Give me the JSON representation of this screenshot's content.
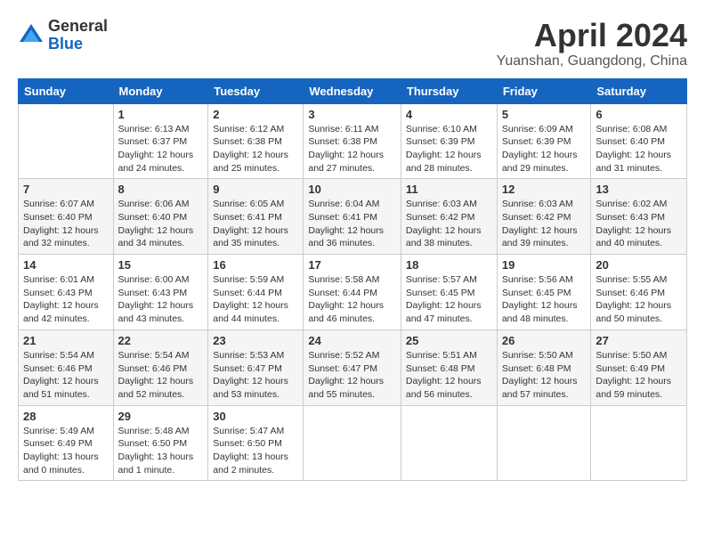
{
  "logo": {
    "general": "General",
    "blue": "Blue"
  },
  "title": "April 2024",
  "location": "Yuanshan, Guangdong, China",
  "columns": [
    "Sunday",
    "Monday",
    "Tuesday",
    "Wednesday",
    "Thursday",
    "Friday",
    "Saturday"
  ],
  "weeks": [
    [
      {
        "day": "",
        "info": ""
      },
      {
        "day": "1",
        "info": "Sunrise: 6:13 AM\nSunset: 6:37 PM\nDaylight: 12 hours\nand 24 minutes."
      },
      {
        "day": "2",
        "info": "Sunrise: 6:12 AM\nSunset: 6:38 PM\nDaylight: 12 hours\nand 25 minutes."
      },
      {
        "day": "3",
        "info": "Sunrise: 6:11 AM\nSunset: 6:38 PM\nDaylight: 12 hours\nand 27 minutes."
      },
      {
        "day": "4",
        "info": "Sunrise: 6:10 AM\nSunset: 6:39 PM\nDaylight: 12 hours\nand 28 minutes."
      },
      {
        "day": "5",
        "info": "Sunrise: 6:09 AM\nSunset: 6:39 PM\nDaylight: 12 hours\nand 29 minutes."
      },
      {
        "day": "6",
        "info": "Sunrise: 6:08 AM\nSunset: 6:40 PM\nDaylight: 12 hours\nand 31 minutes."
      }
    ],
    [
      {
        "day": "7",
        "info": "Sunrise: 6:07 AM\nSunset: 6:40 PM\nDaylight: 12 hours\nand 32 minutes."
      },
      {
        "day": "8",
        "info": "Sunrise: 6:06 AM\nSunset: 6:40 PM\nDaylight: 12 hours\nand 34 minutes."
      },
      {
        "day": "9",
        "info": "Sunrise: 6:05 AM\nSunset: 6:41 PM\nDaylight: 12 hours\nand 35 minutes."
      },
      {
        "day": "10",
        "info": "Sunrise: 6:04 AM\nSunset: 6:41 PM\nDaylight: 12 hours\nand 36 minutes."
      },
      {
        "day": "11",
        "info": "Sunrise: 6:03 AM\nSunset: 6:42 PM\nDaylight: 12 hours\nand 38 minutes."
      },
      {
        "day": "12",
        "info": "Sunrise: 6:03 AM\nSunset: 6:42 PM\nDaylight: 12 hours\nand 39 minutes."
      },
      {
        "day": "13",
        "info": "Sunrise: 6:02 AM\nSunset: 6:43 PM\nDaylight: 12 hours\nand 40 minutes."
      }
    ],
    [
      {
        "day": "14",
        "info": "Sunrise: 6:01 AM\nSunset: 6:43 PM\nDaylight: 12 hours\nand 42 minutes."
      },
      {
        "day": "15",
        "info": "Sunrise: 6:00 AM\nSunset: 6:43 PM\nDaylight: 12 hours\nand 43 minutes."
      },
      {
        "day": "16",
        "info": "Sunrise: 5:59 AM\nSunset: 6:44 PM\nDaylight: 12 hours\nand 44 minutes."
      },
      {
        "day": "17",
        "info": "Sunrise: 5:58 AM\nSunset: 6:44 PM\nDaylight: 12 hours\nand 46 minutes."
      },
      {
        "day": "18",
        "info": "Sunrise: 5:57 AM\nSunset: 6:45 PM\nDaylight: 12 hours\nand 47 minutes."
      },
      {
        "day": "19",
        "info": "Sunrise: 5:56 AM\nSunset: 6:45 PM\nDaylight: 12 hours\nand 48 minutes."
      },
      {
        "day": "20",
        "info": "Sunrise: 5:55 AM\nSunset: 6:46 PM\nDaylight: 12 hours\nand 50 minutes."
      }
    ],
    [
      {
        "day": "21",
        "info": "Sunrise: 5:54 AM\nSunset: 6:46 PM\nDaylight: 12 hours\nand 51 minutes."
      },
      {
        "day": "22",
        "info": "Sunrise: 5:54 AM\nSunset: 6:46 PM\nDaylight: 12 hours\nand 52 minutes."
      },
      {
        "day": "23",
        "info": "Sunrise: 5:53 AM\nSunset: 6:47 PM\nDaylight: 12 hours\nand 53 minutes."
      },
      {
        "day": "24",
        "info": "Sunrise: 5:52 AM\nSunset: 6:47 PM\nDaylight: 12 hours\nand 55 minutes."
      },
      {
        "day": "25",
        "info": "Sunrise: 5:51 AM\nSunset: 6:48 PM\nDaylight: 12 hours\nand 56 minutes."
      },
      {
        "day": "26",
        "info": "Sunrise: 5:50 AM\nSunset: 6:48 PM\nDaylight: 12 hours\nand 57 minutes."
      },
      {
        "day": "27",
        "info": "Sunrise: 5:50 AM\nSunset: 6:49 PM\nDaylight: 12 hours\nand 59 minutes."
      }
    ],
    [
      {
        "day": "28",
        "info": "Sunrise: 5:49 AM\nSunset: 6:49 PM\nDaylight: 13 hours\nand 0 minutes."
      },
      {
        "day": "29",
        "info": "Sunrise: 5:48 AM\nSunset: 6:50 PM\nDaylight: 13 hours\nand 1 minute."
      },
      {
        "day": "30",
        "info": "Sunrise: 5:47 AM\nSunset: 6:50 PM\nDaylight: 13 hours\nand 2 minutes."
      },
      {
        "day": "",
        "info": ""
      },
      {
        "day": "",
        "info": ""
      },
      {
        "day": "",
        "info": ""
      },
      {
        "day": "",
        "info": ""
      }
    ]
  ]
}
